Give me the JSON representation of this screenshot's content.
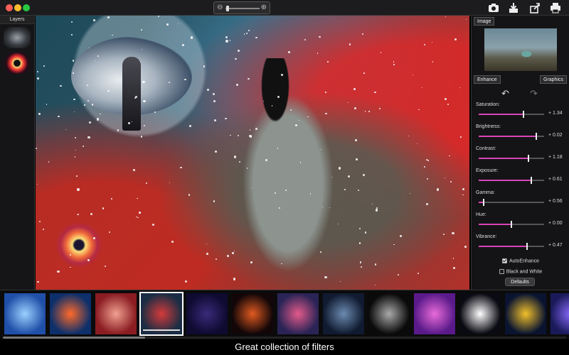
{
  "toolbar": {
    "zoom_out_icon": "zoom-out-icon",
    "zoom_in_icon": "zoom-in-icon",
    "actions": [
      "camera-add-icon",
      "download-icon",
      "share-icon",
      "print-icon"
    ]
  },
  "layers": {
    "title": "Layers"
  },
  "panel": {
    "image_tab": "Image",
    "enhance_tab": "Enhance",
    "graphics_tab": "Graphics",
    "sliders": [
      {
        "label": "Saturation:",
        "value": "+ 1.34",
        "level": 0.68
      },
      {
        "label": "Brightness:",
        "value": "+ 0.02",
        "level": 0.88
      },
      {
        "label": "Contrast:",
        "value": "+ 1.18",
        "level": 0.76
      },
      {
        "label": "Exposure:",
        "value": "+ 0.61",
        "level": 0.8
      },
      {
        "label": "Gamma:",
        "value": "+ 0.56",
        "level": 0.08
      },
      {
        "label": "Hue:",
        "value": "+ 0.00",
        "level": 0.5
      },
      {
        "label": "Vibrance:",
        "value": "+ 0.47",
        "level": 0.74
      }
    ],
    "auto_enhance": "AutoEnhance",
    "black_white": "Black and White",
    "defaults": "Defaults"
  },
  "filters": {
    "selected_index": 3,
    "colors": [
      [
        "#1f4fa8",
        "#9ad0ff"
      ],
      [
        "#0d2f6a",
        "#ff6a2a"
      ],
      [
        "#8a1c22",
        "#f0a090"
      ],
      [
        "#1a2d44",
        "#d33a3a"
      ],
      [
        "#0e0a30",
        "#3a2a7a"
      ],
      [
        "#120608",
        "#e05a20"
      ],
      [
        "#2a2456",
        "#e25a8a"
      ],
      [
        "#101a30",
        "#6b8ab0"
      ],
      [
        "#0a0a0a",
        "#aaaaaa"
      ],
      [
        "#5a1a8a",
        "#e86ad8"
      ],
      [
        "#0a0a12",
        "#ffffff"
      ],
      [
        "#0a1430",
        "#f2c02a"
      ],
      [
        "#1a1a5a",
        "#8a6aff"
      ]
    ]
  },
  "caption": "Great collection of filters"
}
